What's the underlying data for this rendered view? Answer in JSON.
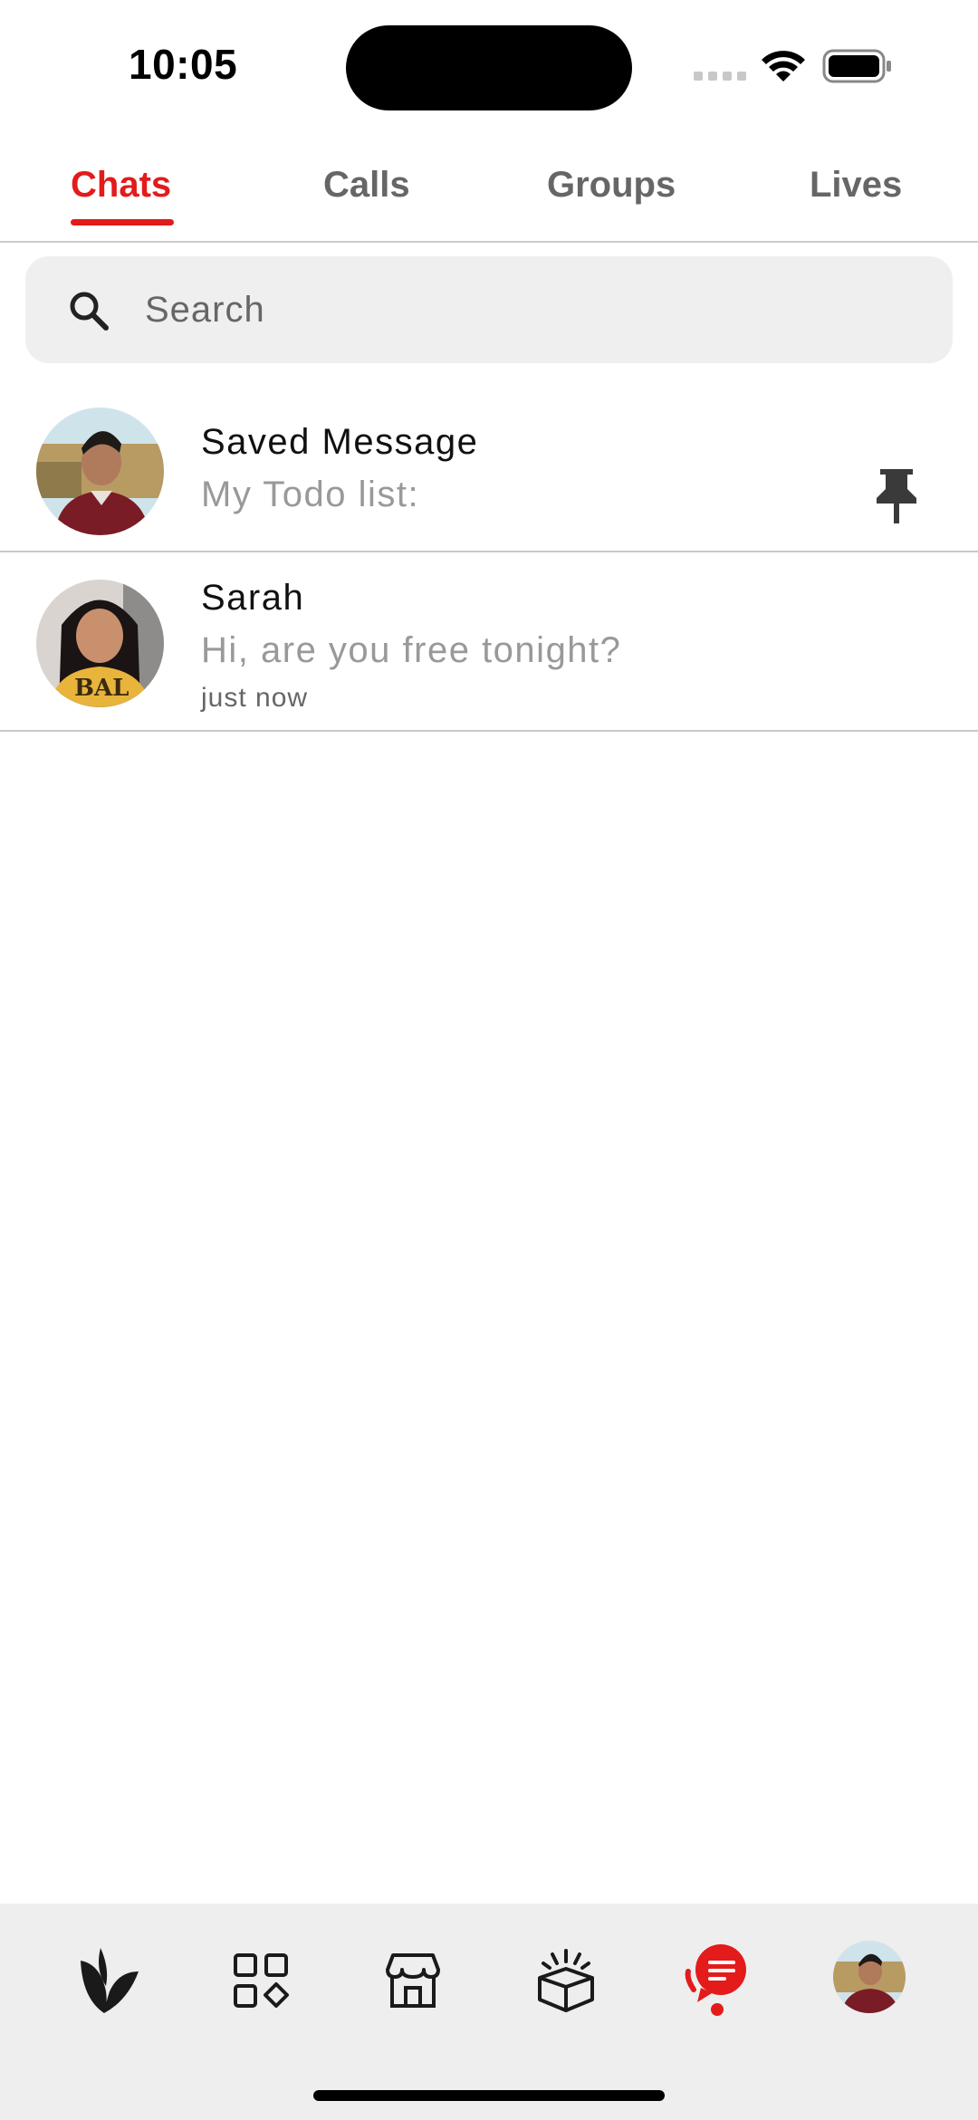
{
  "status_bar": {
    "time": "10:05"
  },
  "tabs": [
    {
      "label": "Chats",
      "active": true
    },
    {
      "label": "Calls",
      "active": false
    },
    {
      "label": "Groups",
      "active": false
    },
    {
      "label": "Lives",
      "active": false
    }
  ],
  "search": {
    "placeholder": "Search",
    "value": "",
    "icon": "search-icon"
  },
  "chats": [
    {
      "name": "Saved Message",
      "preview": "My Todo list:",
      "time": "",
      "pinned": true,
      "pin_icon": "pin-icon"
    },
    {
      "name": "Sarah",
      "preview": "Hi, are you free tonight?",
      "time": "just now",
      "pinned": false
    }
  ],
  "bottom_nav": {
    "items": [
      {
        "icon": "app-logo-icon",
        "active": false
      },
      {
        "icon": "apps-grid-icon",
        "active": false
      },
      {
        "icon": "store-icon",
        "active": false
      },
      {
        "icon": "gift-box-icon",
        "active": false
      },
      {
        "icon": "chat-bubble-icon",
        "active": true
      },
      {
        "icon": "profile-avatar",
        "active": false
      }
    ]
  },
  "colors": {
    "accent": "#e31b1b",
    "tab_inactive": "#666666",
    "search_bg": "#efefef",
    "nav_bg": "#eeeeee",
    "preview_text": "#999999",
    "divider": "#c8c8c8"
  }
}
